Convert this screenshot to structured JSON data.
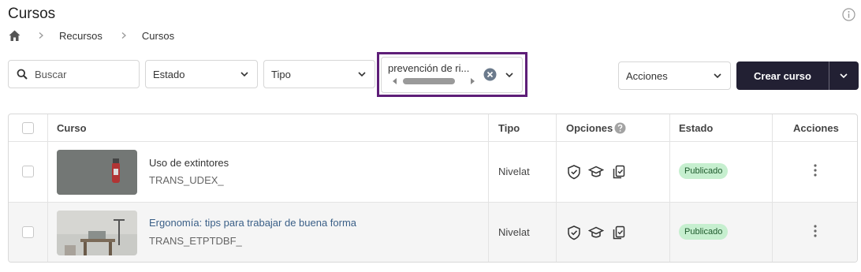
{
  "page": {
    "title": "Cursos"
  },
  "breadcrumb": {
    "items": [
      "Recursos",
      "Cursos"
    ]
  },
  "filters": {
    "search_placeholder": "Buscar",
    "estado_label": "Estado",
    "tipo_label": "Tipo",
    "tag_value": "prevención de ri...",
    "acciones_label": "Acciones",
    "create_label": "Crear curso"
  },
  "table": {
    "headers": {
      "curso": "Curso",
      "tipo": "Tipo",
      "opciones": "Opciones",
      "estado": "Estado",
      "acciones": "Acciones"
    },
    "rows": [
      {
        "title": "Uso de extintores",
        "code": "TRANS_UDEX_",
        "tipo": "Nivelat",
        "estado": "Publicado",
        "title_link": false
      },
      {
        "title": "Ergonomía: tips para trabajar de buena forma",
        "code": "TRANS_ETPTDBF_",
        "tipo": "Nivelat",
        "estado": "Publicado",
        "title_link": true
      }
    ]
  },
  "icons": {
    "home": "home-icon",
    "info": "info-icon",
    "search": "search-icon",
    "clear": "clear-circle-icon",
    "chevron": "chevron-down-icon",
    "shield": "shield-check-icon",
    "cap": "graduation-cap-icon",
    "clipboard": "clipboard-copy-icon",
    "kebab": "kebab-menu-icon",
    "help": "help-circle-icon"
  },
  "colors": {
    "primary_button": "#222033",
    "highlight_border": "#5e1e78",
    "badge_bg": "#c6efcf",
    "link": "#3a5f87"
  }
}
